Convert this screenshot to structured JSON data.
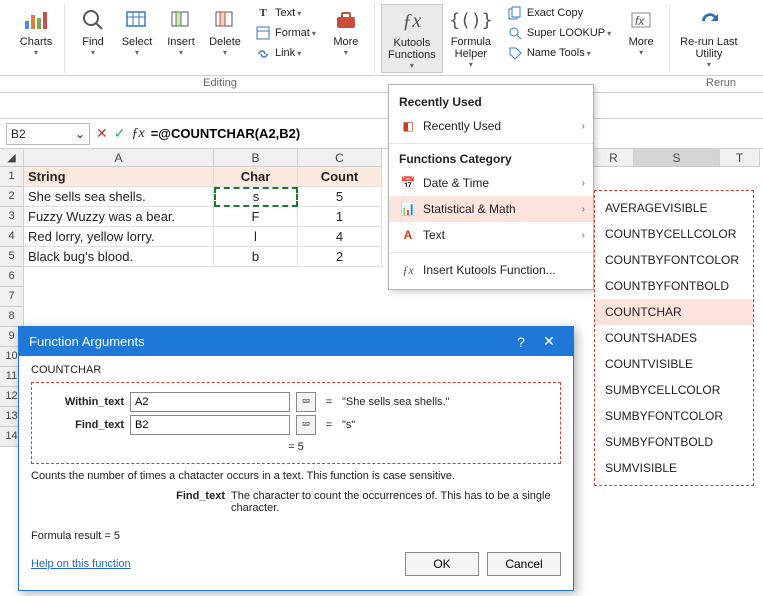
{
  "ribbon": {
    "charts": "Charts",
    "find": "Find",
    "select": "Select",
    "insert": "Insert",
    "delete": "Delete",
    "text": "Text",
    "format": "Format",
    "link": "Link",
    "more1": "More",
    "kutools": "Kutools\nFunctions",
    "formula_helper": "Formula\nHelper",
    "exact_copy": "Exact Copy",
    "super_lookup": "Super LOOKUP",
    "name_tools": "Name Tools",
    "more2": "More",
    "rerun": "Re-run Last\nUtility",
    "group_editing": "Editing",
    "group_rerun": "Rerun"
  },
  "formula_bar": {
    "name": "B2",
    "formula": "=@COUNTCHAR(A2,B2)"
  },
  "columns": [
    "A",
    "B",
    "C",
    "R",
    "S",
    "T"
  ],
  "col_widths": {
    "A": 190,
    "B": 84,
    "C": 84,
    "R": 56,
    "S": 100,
    "T": 56
  },
  "header_row": {
    "A": "String",
    "B": "Char",
    "C": "Count"
  },
  "rows": [
    {
      "n": 2,
      "A": "She sells sea shells.",
      "B": "s",
      "C": "5"
    },
    {
      "n": 3,
      "A": "Fuzzy Wuzzy was a bear.",
      "B": "F",
      "C": "1"
    },
    {
      "n": 4,
      "A": "Red lorry, yellow lorry.",
      "B": "l",
      "C": "4"
    },
    {
      "n": 5,
      "A": "Black bug's blood.",
      "B": "b",
      "C": "2"
    }
  ],
  "menu": {
    "recently_used_hdr": "Recently Used",
    "recently_used": "Recently Used",
    "category_hdr": "Functions Category",
    "date_time": "Date & Time",
    "stat_math": "Statistical & Math",
    "text": "Text",
    "insert_fn": "Insert Kutools Function..."
  },
  "submenu": [
    "AVERAGEVISIBLE",
    "COUNTBYCELLCOLOR",
    "COUNTBYFONTCOLOR",
    "COUNTBYFONTBOLD",
    "COUNTCHAR",
    "COUNTSHADES",
    "COUNTVISIBLE",
    "SUMBYCELLCOLOR",
    "SUMBYFONTCOLOR",
    "SUMBYFONTBOLD",
    "SUMVISIBLE"
  ],
  "submenu_selected": "COUNTCHAR",
  "dialog": {
    "title": "Function Arguments",
    "fn": "COUNTCHAR",
    "arg1_label": "Within_text",
    "arg1_value": "A2",
    "arg1_result": "\"She sells sea shells.\"",
    "arg2_label": "Find_text",
    "arg2_value": "B2",
    "arg2_result": "\"s\"",
    "eq_result": "=   5",
    "desc": "Counts the number of times a chatacter occurs in a text. This function is case sensitive.",
    "argdesc_label": "Find_text",
    "argdesc": "The character to count the occurrences of. This has to be a single character.",
    "formula_result_label": "Formula result =   5",
    "help": "Help on this function",
    "ok": "OK",
    "cancel": "Cancel"
  }
}
